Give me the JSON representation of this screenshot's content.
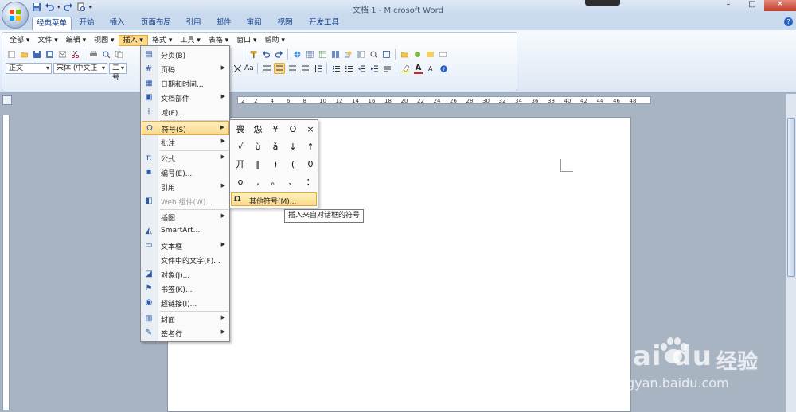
{
  "window": {
    "title": "文档 1 - Microsoft Word",
    "controls": [
      "–",
      "□",
      "✕"
    ]
  },
  "ribbon_tabs": [
    {
      "label": "经典菜单",
      "active": true
    },
    {
      "label": "开始",
      "active": false
    },
    {
      "label": "插入",
      "active": false
    },
    {
      "label": "页面布局",
      "active": false
    },
    {
      "label": "引用",
      "active": false
    },
    {
      "label": "邮件",
      "active": false
    },
    {
      "label": "审阅",
      "active": false
    },
    {
      "label": "视图",
      "active": false
    },
    {
      "label": "开发工具",
      "active": false
    }
  ],
  "classic_menu": [
    {
      "label": "全部 ▾"
    },
    {
      "label": "文件 ▾"
    },
    {
      "label": "编辑 ▾"
    },
    {
      "label": "视图 ▾"
    },
    {
      "label": "插入 ▾",
      "active": true
    },
    {
      "label": "格式 ▾"
    },
    {
      "label": "工具 ▾"
    },
    {
      "label": "表格 ▾"
    },
    {
      "label": "窗口 ▾"
    },
    {
      "label": "帮助 ▾"
    }
  ],
  "format_bar": {
    "style": "正文",
    "font": "宋体 (中文正",
    "size": "二号",
    "font_color_label": "A",
    "aa_label": "Aa"
  },
  "insert_menu": [
    {
      "label": "分页(B)",
      "icon": "page-break-icon",
      "arrow": false
    },
    {
      "label": "页码",
      "icon": "page-number-icon",
      "arrow": true
    },
    {
      "label": "日期和时间...",
      "icon": "calendar-icon",
      "arrow": false
    },
    {
      "label": "文档部件",
      "icon": "quick-parts-icon",
      "arrow": true
    },
    {
      "label": "域(F)...",
      "icon": "field-icon",
      "arrow": false
    },
    {
      "label": "符号(S)",
      "icon": "omega-icon",
      "arrow": true,
      "highlighted": true
    },
    {
      "label": "批注",
      "icon": "",
      "arrow": true
    },
    {
      "label": "公式",
      "icon": "pi-icon",
      "arrow": true
    },
    {
      "label": "编号(E)...",
      "icon": "numbering-icon",
      "arrow": false
    },
    {
      "label": "引用",
      "icon": "",
      "arrow": true
    },
    {
      "label": "Web 组件(W)...",
      "icon": "web-component-icon",
      "arrow": false,
      "disabled": true
    },
    {
      "label": "插图",
      "icon": "",
      "arrow": true
    },
    {
      "label": "SmartArt...",
      "icon": "smartart-icon",
      "arrow": false
    },
    {
      "label": "文本框",
      "icon": "textbox-icon",
      "arrow": true
    },
    {
      "label": "文件中的文字(F)...",
      "icon": "",
      "arrow": false
    },
    {
      "label": "对象(J)...",
      "icon": "object-icon",
      "arrow": false
    },
    {
      "label": "书签(K)...",
      "icon": "bookmark-icon",
      "arrow": false
    },
    {
      "label": "超链接(I)...",
      "icon": "hyperlink-icon",
      "arrow": false
    },
    {
      "label": "封面",
      "icon": "cover-page-icon",
      "arrow": true
    },
    {
      "label": "签名行",
      "icon": "signature-icon",
      "arrow": true
    }
  ],
  "symbol_menu": {
    "symbols": [
      "喪",
      "怹",
      "¥",
      "O",
      "×",
      "√",
      "ù",
      "ǎ",
      "↓",
      "↑",
      "丌",
      "‖",
      ")",
      "(",
      "0",
      "o",
      ",",
      "。",
      "、",
      "："
    ],
    "more_label": "其他符号(M)...",
    "more_icon": "Ω"
  },
  "tooltip": "插入来自对话框的符号",
  "ruler_numbers": [
    "2",
    "2",
    "4",
    "6",
    "8",
    "10",
    "12",
    "14",
    "16",
    "18",
    "20",
    "22",
    "24",
    "26",
    "28",
    "30",
    "32",
    "34",
    "36",
    "38",
    "40",
    "42",
    "44",
    "46",
    "48"
  ],
  "watermark": {
    "brand": "Bai  du",
    "cn": "经验",
    "url": "jingyan.baidu.com"
  }
}
